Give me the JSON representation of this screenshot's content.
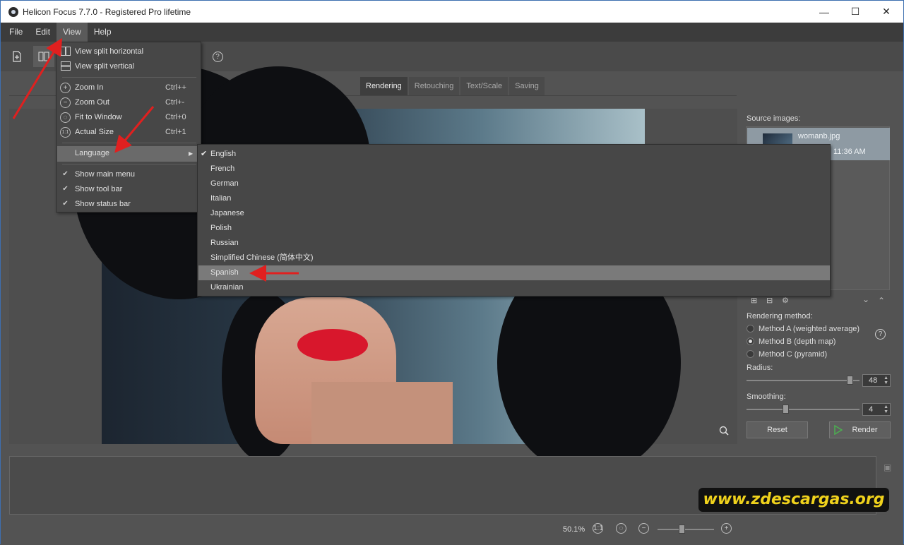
{
  "window": {
    "title": "Helicon Focus 7.7.0 - Registered Pro lifetime",
    "minimize": "—",
    "maximize": "☐",
    "close": "✕"
  },
  "menubar": [
    "File",
    "Edit",
    "View",
    "Help"
  ],
  "view_menu": {
    "items": [
      {
        "label": "View split horizontal",
        "shortcut": "",
        "icon": "split-horizontal-icon"
      },
      {
        "label": "View split vertical",
        "shortcut": "",
        "icon": "split-vertical-icon"
      },
      {
        "label": "Zoom In",
        "shortcut": "Ctrl++",
        "icon": "zoom-in-icon"
      },
      {
        "label": "Zoom Out",
        "shortcut": "Ctrl+-",
        "icon": "zoom-out-icon"
      },
      {
        "label": "Fit to Window",
        "shortcut": "Ctrl+0",
        "icon": "fit-window-icon"
      },
      {
        "label": "Actual Size",
        "shortcut": "Ctrl+1",
        "icon": "actual-size-icon"
      },
      {
        "label": "Language",
        "shortcut": "",
        "icon": ""
      },
      {
        "label": "Show main menu",
        "shortcut": "",
        "icon": "check-icon"
      },
      {
        "label": "Show tool bar",
        "shortcut": "",
        "icon": "check-icon"
      },
      {
        "label": "Show status bar",
        "shortcut": "",
        "icon": "check-icon"
      }
    ]
  },
  "language_menu": {
    "items": [
      "English",
      "French",
      "German",
      "Italian",
      "Japanese",
      "Polish",
      "Russian",
      "Simplified Chinese (简体中文)",
      "Spanish",
      "Ukrainian"
    ],
    "checked": "English",
    "highlighted": "Spanish"
  },
  "tabs": [
    "Rendering",
    "Retouching",
    "Text/Scale",
    "Saving"
  ],
  "right_panel": {
    "source_label": "Source images:",
    "source_file": "womanb.jpg",
    "source_time": "11:36 AM",
    "method_label": "Rendering method:",
    "methods": [
      "Method A (weighted average)",
      "Method B (depth map)",
      "Method C (pyramid)"
    ],
    "selected_method": "Method B (depth map)",
    "radius_label": "Radius:",
    "radius_value": "48",
    "smoothing_label": "Smoothing:",
    "smoothing_value": "4",
    "reset_label": "Reset",
    "render_label": "Render",
    "help": "?"
  },
  "status": {
    "zoom": "50.1%"
  },
  "watermark": "www.zdescargas.org",
  "colors": {
    "accent_render": "#4caf50",
    "annotation_red": "#e0201f",
    "lips": "#d8172c"
  }
}
